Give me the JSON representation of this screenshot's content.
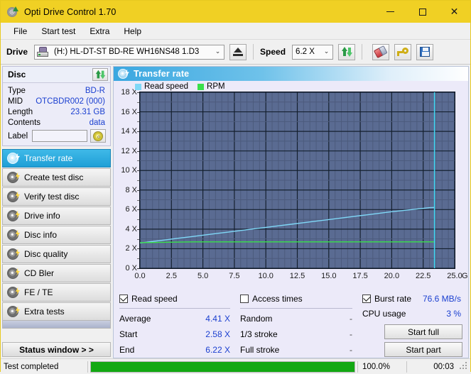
{
  "window": {
    "title": "Opti Drive Control 1.70",
    "icon": "disc-icon",
    "minimize_label": "–",
    "maximize_label": "□",
    "close_label": "✕"
  },
  "menu": {
    "items": [
      {
        "label": "File"
      },
      {
        "label": "Start test"
      },
      {
        "label": "Extra"
      },
      {
        "label": "Help"
      }
    ]
  },
  "toolbar": {
    "drive_label": "Drive",
    "drive_value": "(H:) HL-DT-ST BD-RE  WH16NS48 1.D3",
    "eject_icon": "eject-icon",
    "speed_label": "Speed",
    "speed_value": "6.2 X",
    "refresh_icon": "refresh-icon",
    "erase_icon": "erase-icon",
    "key_icon": "key-icon",
    "save_icon": "save-icon",
    "caret": "⌄"
  },
  "disc_panel": {
    "title": "Disc",
    "refresh_icon": "refresh-disc-icon",
    "rows": [
      {
        "key": "Type",
        "value": "BD-R"
      },
      {
        "key": "MID",
        "value": "OTCBDR002 (000)"
      },
      {
        "key": "Length",
        "value": "23.31 GB"
      },
      {
        "key": "Contents",
        "value": "data"
      }
    ],
    "label_key": "Label",
    "label_value": "",
    "label_placeholder": "",
    "label_button_icon": "disc-label-icon"
  },
  "sidebar": {
    "items": [
      {
        "label": "Transfer rate",
        "active": true
      },
      {
        "label": "Create test disc",
        "active": false
      },
      {
        "label": "Verify test disc",
        "active": false
      },
      {
        "label": "Drive info",
        "active": false
      },
      {
        "label": "Disc info",
        "active": false
      },
      {
        "label": "Disc quality",
        "active": false
      },
      {
        "label": "CD Bler",
        "active": false
      },
      {
        "label": "FE / TE",
        "active": false
      },
      {
        "label": "Extra tests",
        "active": false
      }
    ],
    "status_window_label": "Status window > >"
  },
  "panel": {
    "title": "Transfer rate",
    "icon": "transfer-rate-icon"
  },
  "chart_data": {
    "type": "line",
    "title": "Transfer rate",
    "xlabel": "GB",
    "ylabel": "X",
    "xlim": [
      0.0,
      25.0
    ],
    "ylim": [
      0,
      18
    ],
    "xticks": [
      0.0,
      2.5,
      5.0,
      7.5,
      10.0,
      12.5,
      15.0,
      17.5,
      20.0,
      22.5,
      25.0
    ],
    "xticklabels": [
      "0.0",
      "2.5",
      "5.0",
      "7.5",
      "10.0",
      "12.5",
      "15.0",
      "17.5",
      "20.0",
      "22.5",
      "25.0"
    ],
    "x_unit_label": "GB",
    "yticks": [
      0,
      2,
      4,
      6,
      8,
      10,
      12,
      14,
      16,
      18
    ],
    "yticklabels": [
      "0 X",
      "2 X",
      "4 X",
      "6 X",
      "8 X",
      "10 X",
      "12 X",
      "14 X",
      "16 X",
      "18 X"
    ],
    "grid": true,
    "plot_bg": "#5a6b92",
    "grid_color": "#4c5b7d",
    "grid_major_color": "#15202f",
    "legend_position": "top-left",
    "legend": [
      {
        "name": "Read speed",
        "color": "#7fd8f7"
      },
      {
        "name": "RPM",
        "color": "#39e04b"
      }
    ],
    "series": [
      {
        "name": "Read speed",
        "color": "#7fd8f7",
        "x": [
          0.0,
          1.0,
          2.0,
          3.0,
          4.0,
          5.0,
          6.0,
          7.0,
          8.0,
          9.0,
          10.0,
          11.0,
          12.0,
          13.0,
          14.0,
          15.0,
          16.0,
          17.0,
          18.0,
          19.0,
          20.0,
          21.0,
          22.0,
          23.0,
          23.4
        ],
        "y": [
          2.58,
          2.74,
          2.9,
          3.06,
          3.22,
          3.38,
          3.54,
          3.7,
          3.86,
          4.02,
          4.18,
          4.34,
          4.5,
          4.66,
          4.82,
          4.98,
          5.14,
          5.3,
          5.46,
          5.62,
          5.78,
          5.92,
          6.06,
          6.2,
          6.22
        ]
      },
      {
        "name": "RPM",
        "color": "#39e04b",
        "x": [
          0.0,
          4.3,
          23.4
        ],
        "y": [
          2.62,
          2.7,
          2.7
        ]
      }
    ],
    "markers": [
      {
        "name": "end-marker",
        "type": "vline",
        "x": 23.4,
        "color": "#3fd4ef"
      }
    ]
  },
  "results": {
    "read_speed": {
      "checkbox_label": "Read speed",
      "checked": true,
      "rows": [
        {
          "key": "Average",
          "value": "4.41 X"
        },
        {
          "key": "Start",
          "value": "2.58 X"
        },
        {
          "key": "End",
          "value": "6.22 X"
        }
      ]
    },
    "access_times": {
      "checkbox_label": "Access times",
      "checked": false,
      "rows": [
        {
          "key": "Random",
          "value": "-"
        },
        {
          "key": "1/3 stroke",
          "value": "-"
        },
        {
          "key": "Full stroke",
          "value": "-"
        }
      ]
    },
    "burst_rate": {
      "checkbox_label": "Burst rate",
      "checked": true,
      "value": "76.6 MB/s",
      "cpu_key": "CPU usage",
      "cpu_value": "3 %"
    },
    "buttons": [
      {
        "label": "Start full"
      },
      {
        "label": "Start part"
      }
    ]
  },
  "statusbar": {
    "message": "Test completed",
    "progress_percent": 100.0,
    "progress_label": "100.0%",
    "elapsed": "00:03",
    "progress_color": "#12a812"
  }
}
